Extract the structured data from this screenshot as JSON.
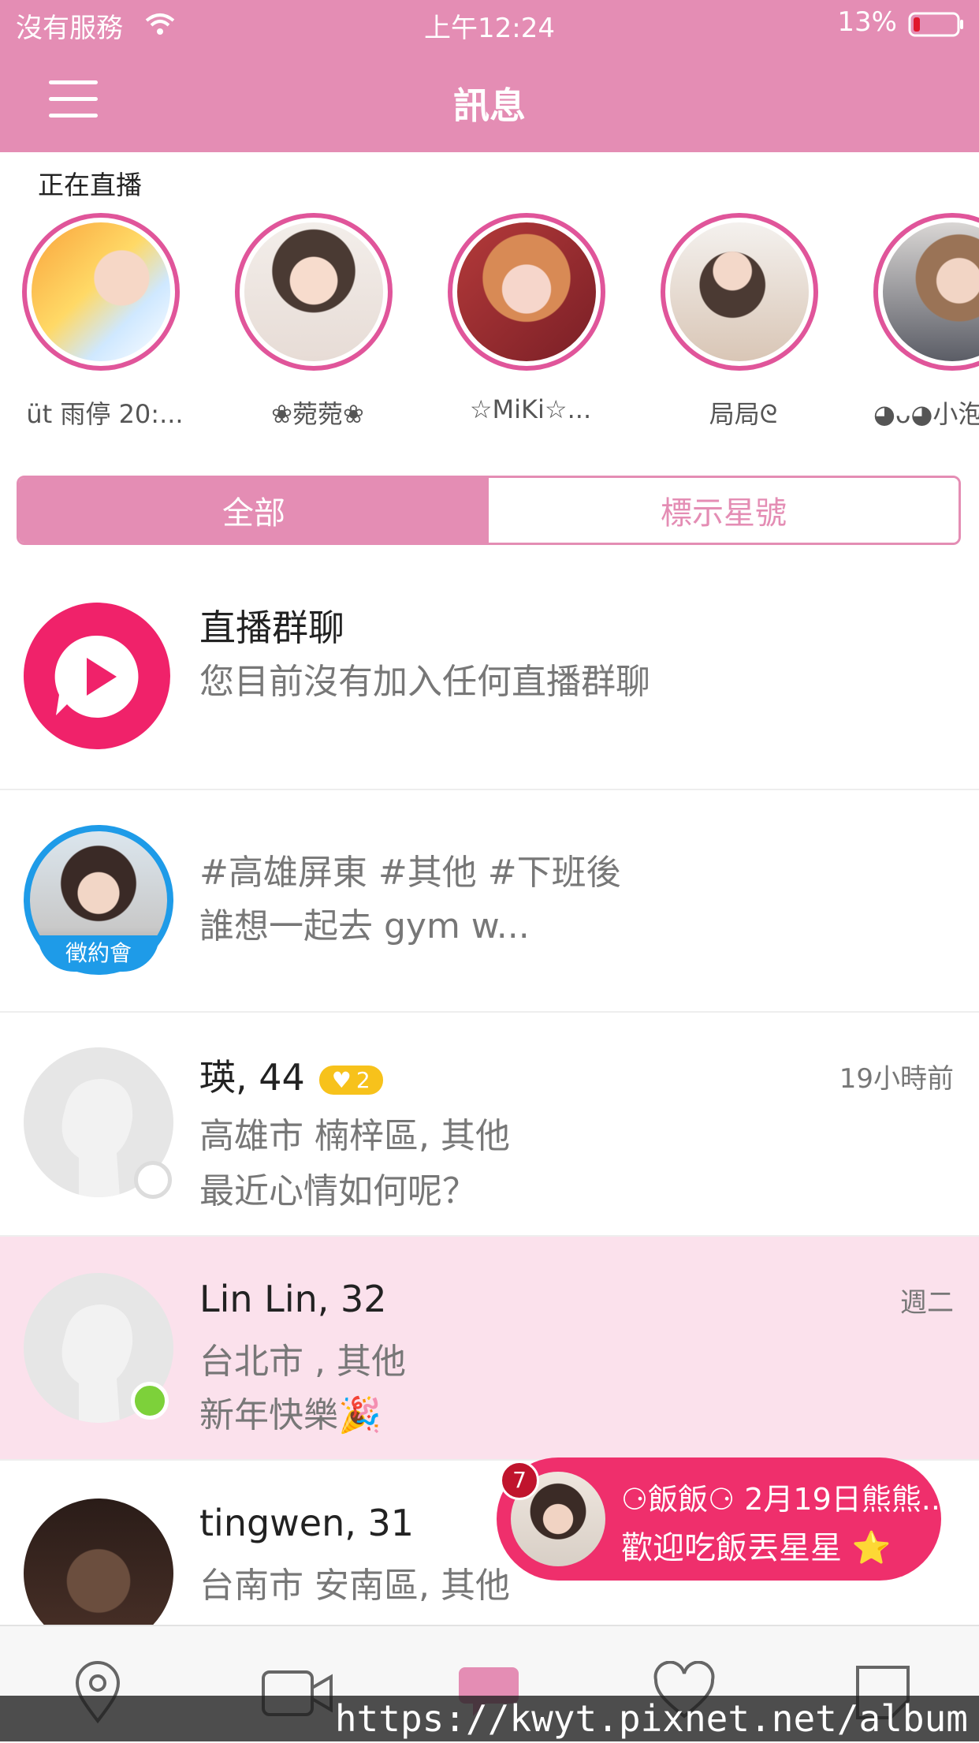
{
  "status": {
    "carrier": "沒有服務",
    "time": "上午12:24",
    "battery": "13%"
  },
  "header": {
    "title": "訊息"
  },
  "live": {
    "heading": "正在直播",
    "items": [
      {
        "name": "üt 雨停 20:..."
      },
      {
        "name": "❀菀菀❀"
      },
      {
        "name": "☆MiKi☆..."
      },
      {
        "name": "局局ᘓ"
      },
      {
        "name": "◕ᴗ◕小泡"
      }
    ]
  },
  "tabs": {
    "all": "全部",
    "starred": "標示星號"
  },
  "live_group": {
    "title": "直播群聊",
    "subtitle": "您目前沒有加入任何直播群聊"
  },
  "dating_post": {
    "tags": "#高雄屏東 #其他 #下班後",
    "preview": "誰想一起去 gym w...",
    "badge": "徵約會"
  },
  "messages": [
    {
      "name": "瑛, 44",
      "badge": "2",
      "time": "19小時前",
      "location": "高雄市 楠梓區, 其他",
      "preview": "最近心情如何呢？"
    },
    {
      "name": "Lin Lin, 32",
      "time": "週二",
      "location": "台北市 , 其他",
      "preview": "新年快樂🎉"
    },
    {
      "name": "tingwen, 31",
      "time": "",
      "location": "台南市 安南區, 其他",
      "preview": ""
    }
  ],
  "toast": {
    "count": "7",
    "line1": "⚆飯飯⚆ 2月19日熊熊...",
    "line2": "歡迎吃飯丟星星 ⭐"
  },
  "watermark": "https://kwyt.pixnet.net/album",
  "colors": {
    "brand_pink": "#e48db4",
    "accent_red": "#ef2f6c",
    "online_green": "#7dd13a"
  }
}
